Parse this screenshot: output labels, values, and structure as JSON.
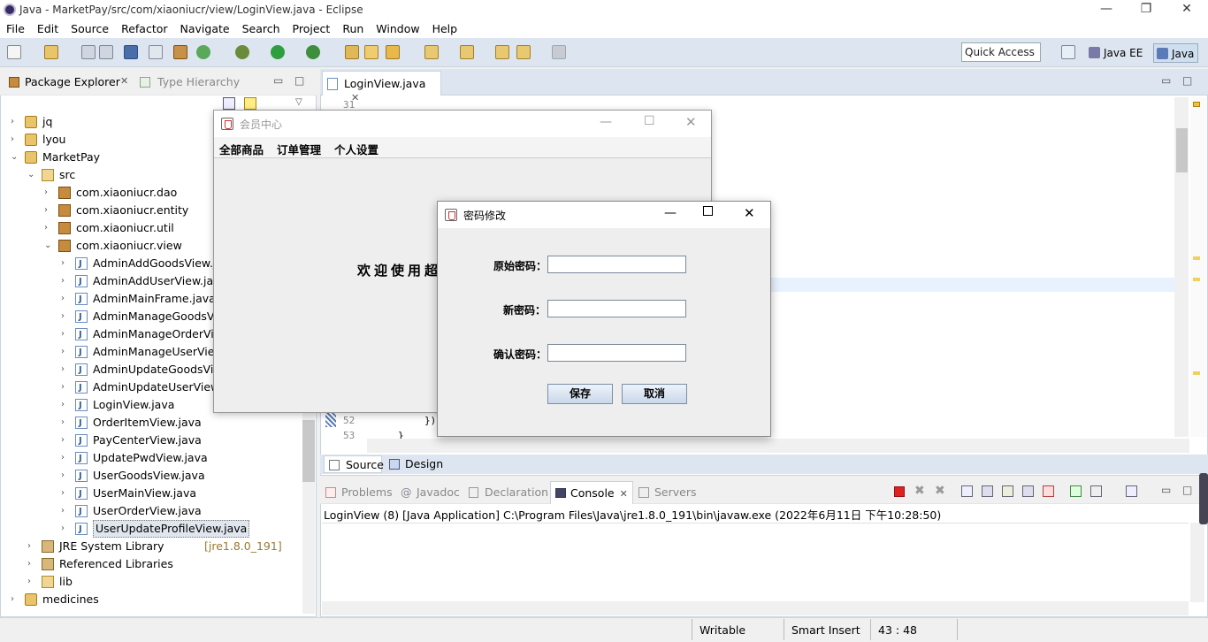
{
  "window": {
    "title": "Java - MarketPay/src/com/xiaoniucr/view/LoginView.java - Eclipse"
  },
  "menu": [
    "File",
    "Edit",
    "Source",
    "Refactor",
    "Navigate",
    "Search",
    "Project",
    "Run",
    "Window",
    "Help"
  ],
  "toolbar": {
    "quick_access": "Quick Access",
    "perspectives": [
      "Java EE",
      "Java"
    ]
  },
  "package_explorer": {
    "tabs": [
      "Package Explorer",
      "Type Hierarchy"
    ],
    "tree": [
      {
        "label": "jq",
        "type": "proj",
        "level": 0,
        "open": false
      },
      {
        "label": "lyou",
        "type": "proj",
        "level": 0,
        "open": false
      },
      {
        "label": "MarketPay",
        "type": "proj",
        "level": 0,
        "open": true
      },
      {
        "label": "src",
        "type": "folder",
        "level": 1,
        "open": true
      },
      {
        "label": "com.xiaoniucr.dao",
        "type": "pkg",
        "level": 2,
        "open": false
      },
      {
        "label": "com.xiaoniucr.entity",
        "type": "pkg",
        "level": 2,
        "open": false
      },
      {
        "label": "com.xiaoniucr.util",
        "type": "pkg",
        "level": 2,
        "open": false
      },
      {
        "label": "com.xiaoniucr.view",
        "type": "pkg",
        "level": 2,
        "open": true
      },
      {
        "label": "AdminAddGoodsView.java",
        "type": "java",
        "level": 3
      },
      {
        "label": "AdminAddUserView.java",
        "type": "java",
        "level": 3
      },
      {
        "label": "AdminMainFrame.java",
        "type": "java",
        "level": 3
      },
      {
        "label": "AdminManageGoodsView.java",
        "type": "java",
        "level": 3
      },
      {
        "label": "AdminManageOrderView.java",
        "type": "java",
        "level": 3
      },
      {
        "label": "AdminManageUserView.java",
        "type": "java",
        "level": 3
      },
      {
        "label": "AdminUpdateGoodsView.java",
        "type": "java",
        "level": 3
      },
      {
        "label": "AdminUpdateUserView.java",
        "type": "java",
        "level": 3
      },
      {
        "label": "LoginView.java",
        "type": "java",
        "level": 3
      },
      {
        "label": "OrderItemView.java",
        "type": "java",
        "level": 3
      },
      {
        "label": "PayCenterView.java",
        "type": "java",
        "level": 3
      },
      {
        "label": "UpdatePwdView.java",
        "type": "java",
        "level": 3
      },
      {
        "label": "UserGoodsView.java",
        "type": "java",
        "level": 3
      },
      {
        "label": "UserMainView.java",
        "type": "java",
        "level": 3
      },
      {
        "label": "UserOrderView.java",
        "type": "java",
        "level": 3
      },
      {
        "label": "UserUpdateProfileView.java",
        "type": "java",
        "level": 3,
        "selected": true
      },
      {
        "label": "JRE System Library",
        "suffix": "[jre1.8.0_191]",
        "type": "lib",
        "level": 1,
        "open": false
      },
      {
        "label": "Referenced Libraries",
        "type": "lib",
        "level": 1,
        "open": false
      },
      {
        "label": "lib",
        "type": "folder",
        "level": 1,
        "open": false
      },
      {
        "label": "medicines",
        "type": "proj",
        "level": 0,
        "open": false
      }
    ]
  },
  "editor": {
    "tab": "LoginView.java",
    "line_numbers": [
      "31",
      "52",
      "53"
    ],
    "code_fragments": [
      "});",
      "}"
    ],
    "bottom_tabs": [
      "Source",
      "Design"
    ]
  },
  "console": {
    "tabs": [
      "Problems",
      "Javadoc",
      "Declaration",
      "Console",
      "Servers"
    ],
    "status": "LoginView (8) [Java Application] C:\\Program Files\\Java\\jre1.8.0_191\\bin\\javaw.exe (2022年6月11日 下午10:28:50)"
  },
  "statusbar": {
    "writable": "Writable",
    "insert": "Smart Insert",
    "position": "43 : 48"
  },
  "member_window": {
    "title": "会员中心",
    "menus": [
      "全部商品",
      "订单管理",
      "个人设置"
    ],
    "welcome": "欢迎使用超"
  },
  "password_dialog": {
    "title": "密码修改",
    "labels": [
      "原始密码：",
      "新密码：",
      "确认密码："
    ],
    "save": "保存",
    "cancel": "取消"
  }
}
